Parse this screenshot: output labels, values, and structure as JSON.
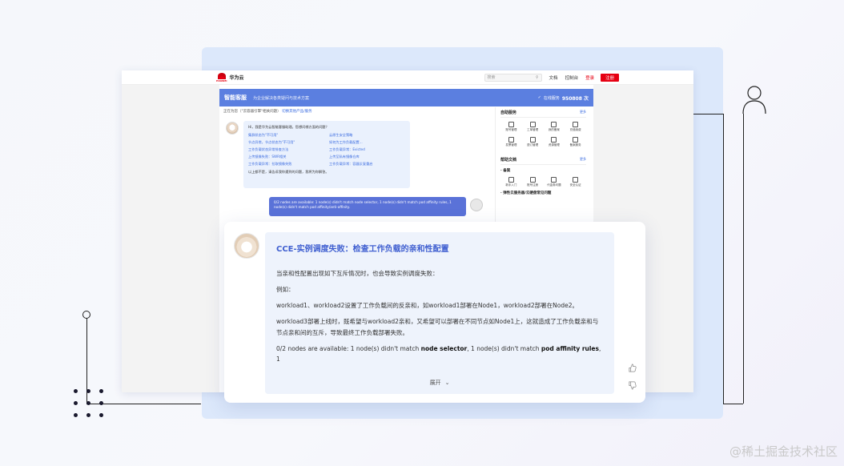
{
  "topnav": {
    "brand": "华为云",
    "brand_sub": "HUAWEI",
    "search_placeholder": "搜索",
    "links": [
      "文档",
      "控制台"
    ],
    "login": "登录",
    "register": "注册"
  },
  "header": {
    "title": "智能客服",
    "subtitle": "为企业解决各类疑问与技术方案",
    "online_prefix": "在线服务",
    "online_count": "950808 次"
  },
  "notice": {
    "text": "正在为您（\"云容器引擎\"相关问题）",
    "link": "切换其他产品/服务"
  },
  "bot_bubble": {
    "intro": "Hi，我是华为云智能客服助理。您想问哪方面的问题？",
    "questions": [
      "集群状态为\"不可用\"",
      "云原生安全策略",
      "节点异常，节点状态为\"不可用\"",
      "如何为工作负载配置...",
      "工作负载状态异常排查方法",
      "工作负载异常：Evicted",
      "上传镜像失败：SWR相关",
      "上传至私有镜像仓库",
      "工作负载异常：拉取镜像失败",
      "工作负载异常：容器反复重启"
    ],
    "footer": "以上都不是，请告诉我你遇到的问题，我将为你解答。"
  },
  "user_bubble": {
    "text": "0/2 nodes are available: 1 node(s) didn't match node selector, 1 node(s) didn't match pod affinity rules, 1 node(s) didn't match pod affinity/anti-affinity."
  },
  "side_panel": {
    "section1_title": "自助服务",
    "section1_more": "更多",
    "section1_items": [
      "账号管理",
      "工单管理",
      "我的备案",
      "充值续费",
      "发票管理",
      "退订管理",
      "资源管理",
      "备案服务"
    ],
    "section2_title": "帮助文档",
    "section2_more": "更多",
    "section2_sub": "· 备案",
    "section2_items": [
      "新手入门",
      "账号注册",
      "代金券问题",
      "安全认证"
    ],
    "section2_link": "· 弹性云服务器/云硬盘常见问题"
  },
  "answer": {
    "title": "CCE-实例调度失败：检查工作负载的亲和性配置",
    "p1": "当亲和性配置出现如下互斥情况时，也会导致实例调度失败：",
    "p2": "例如：",
    "p3": "workload1、workload2设置了工作负载间的反亲和，如workload1部署在Node1，workload2部署在Node2。",
    "p4": "workload3部署上线时，既希望与workload2亲和，又希望可以部署在不同节点如Node1上，这就造成了工作负载亲和与节点亲和间的互斥，导致最终工作负载部署失败。",
    "p5_a": "0/2 nodes are available: 1 node(s) didn't match ",
    "p5_b": "node selector",
    "p5_c": ", 1 node(s) didn't match ",
    "p5_d": "pod affinity rules",
    "p5_e": ", 1",
    "expand": "展开"
  },
  "watermark": "@稀土掘金技术社区",
  "colors": {
    "accent": "#5b7fe0",
    "title_blue": "#3f5fd0",
    "brand_red": "#e60012",
    "answer_bg": "#eef3fc"
  }
}
